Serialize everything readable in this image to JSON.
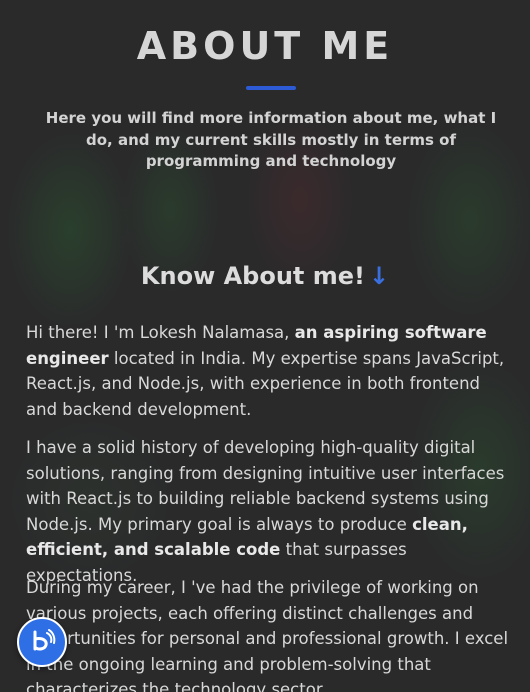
{
  "header": {
    "title": "ABOUT ME",
    "intro": "Here you will find more information about me, what I do, and my current skills mostly in terms of programming and technology"
  },
  "section": {
    "heading": "Know About me!",
    "arrow_icon": "arrow-down-icon",
    "accent_color": "#2d5bd6"
  },
  "paragraphs": {
    "p1": {
      "a": "Hi there! I 'm Lokesh Nalamasa, ",
      "b": "an aspiring software engineer",
      "c": " located in India. My expertise spans JavaScript, React.js, and Node.js, with experience in both frontend and backend development."
    },
    "p2": {
      "a": "I have a solid history of developing high-quality digital solutions, ranging from designing intuitive user interfaces with React.js to building reliable backend systems using Node.js. My primary goal is always to produce ",
      "b": "clean, efficient, and scalable code",
      "c": " that surpasses expectations."
    },
    "p3": {
      "a": "During my career, I 've had the privilege of working on various projects, each offering distinct challenges and opportunities for personal and professional growth. I excel in the ongoing learning and problem-solving that characterizes the technology sector."
    }
  },
  "fab": {
    "icon": "chat-bot-icon",
    "color": "#2f6fe6"
  }
}
